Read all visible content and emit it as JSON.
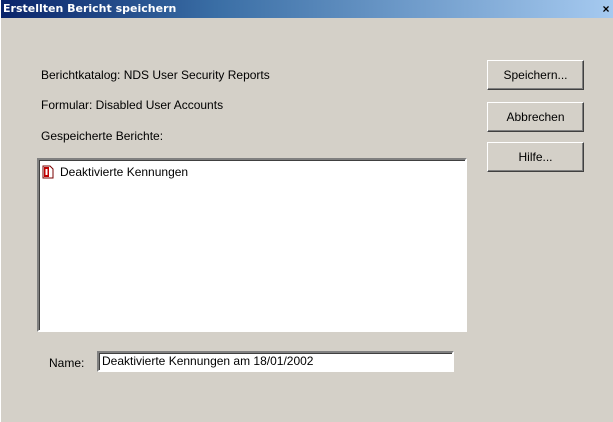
{
  "window": {
    "title": "Erstellten Bericht speichern",
    "close_label": "×"
  },
  "info": {
    "catalog": "Berichtkatalog: NDS User Security Reports",
    "form": "Formular: Disabled User Accounts",
    "saved_reports_label": "Gespeicherte Berichte:"
  },
  "saved_reports": [
    {
      "label": "Deaktivierte Kennungen",
      "icon": "report-document-icon"
    }
  ],
  "name_field": {
    "label": "Name:",
    "value": "Deaktivierte Kennungen am 18/01/2002"
  },
  "buttons": {
    "save": "Speichern...",
    "cancel": "Abbrechen",
    "help": "Hilfe..."
  },
  "colors": {
    "titlebar_start": "#0a246a",
    "titlebar_end": "#a6caf0",
    "dialog_background": "#d4d0c8"
  }
}
